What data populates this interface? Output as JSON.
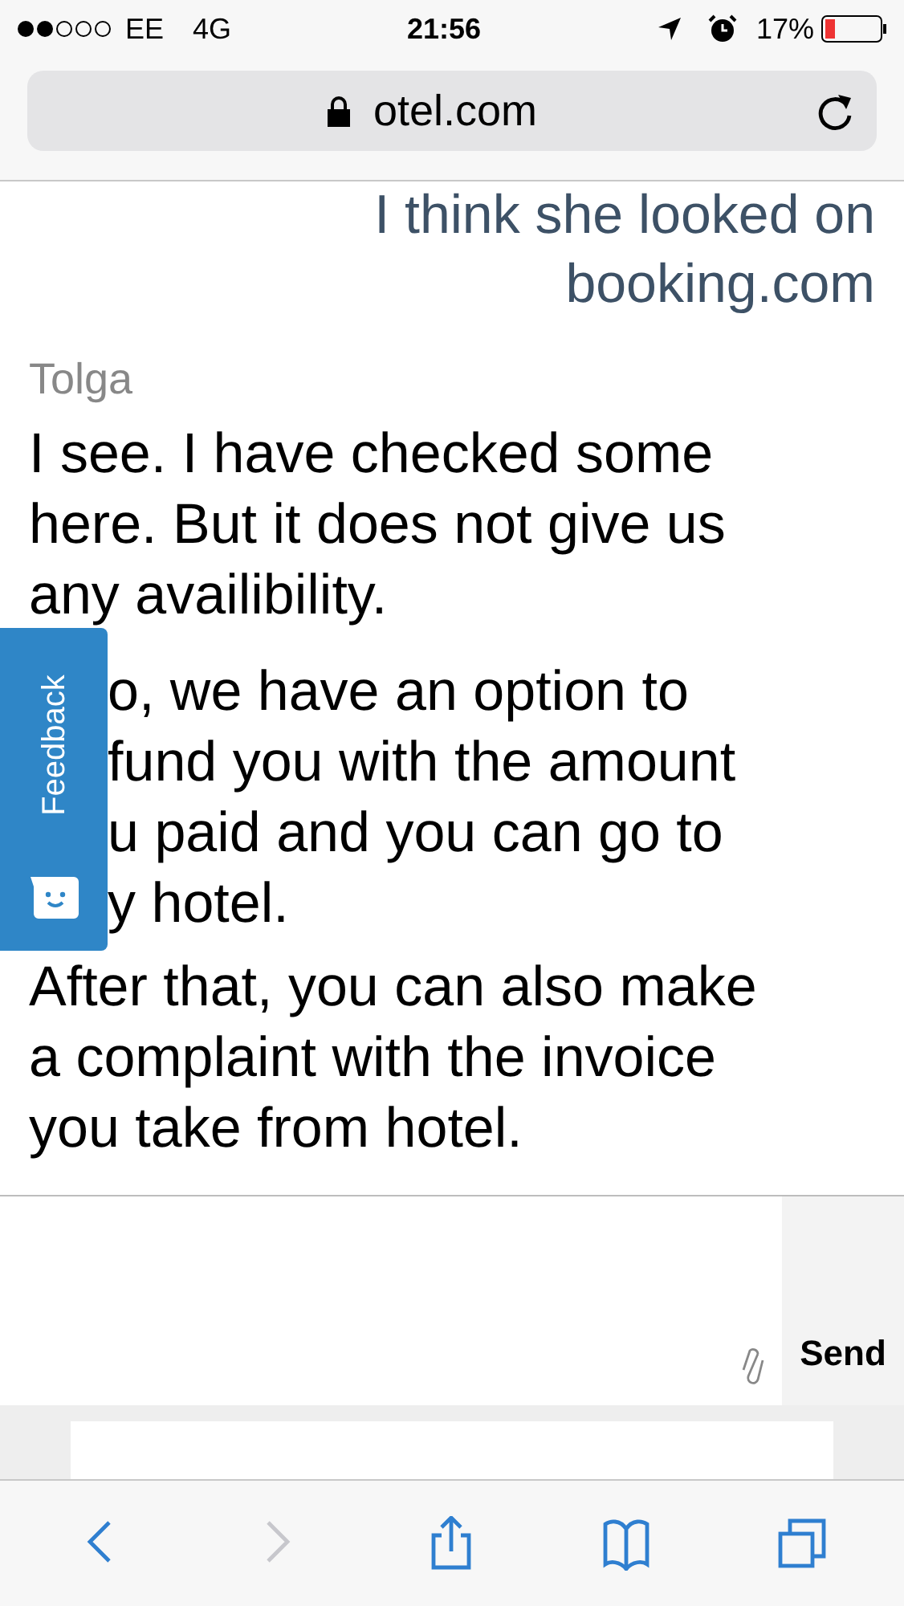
{
  "status_bar": {
    "carrier": "EE",
    "network": "4G",
    "time": "21:56",
    "battery": "17%"
  },
  "address_bar": {
    "url": "otel.com"
  },
  "chat": {
    "outgoing": "I think she looked on booking.com",
    "sender": "Tolga",
    "messages": [
      {
        "kind": "text",
        "text": "I see. I have checked some here. But it does not give us any availibility."
      },
      {
        "kind": "covered",
        "lines": [
          "o, we have an option to",
          "fund you with the amount",
          "u paid and you can go to",
          "y hotel."
        ]
      },
      {
        "kind": "text",
        "text": "After that, you can also make a complaint with the invoice you take from hotel."
      }
    ]
  },
  "feedback_tab": {
    "label": "Feedback"
  },
  "composer": {
    "send": "Send"
  },
  "toolbar": [
    {
      "kind": "back",
      "disabled": false
    },
    {
      "kind": "forward",
      "disabled": true
    },
    {
      "kind": "share",
      "disabled": false
    },
    {
      "kind": "bookmarks",
      "disabled": false
    },
    {
      "kind": "tabs",
      "disabled": false
    }
  ]
}
